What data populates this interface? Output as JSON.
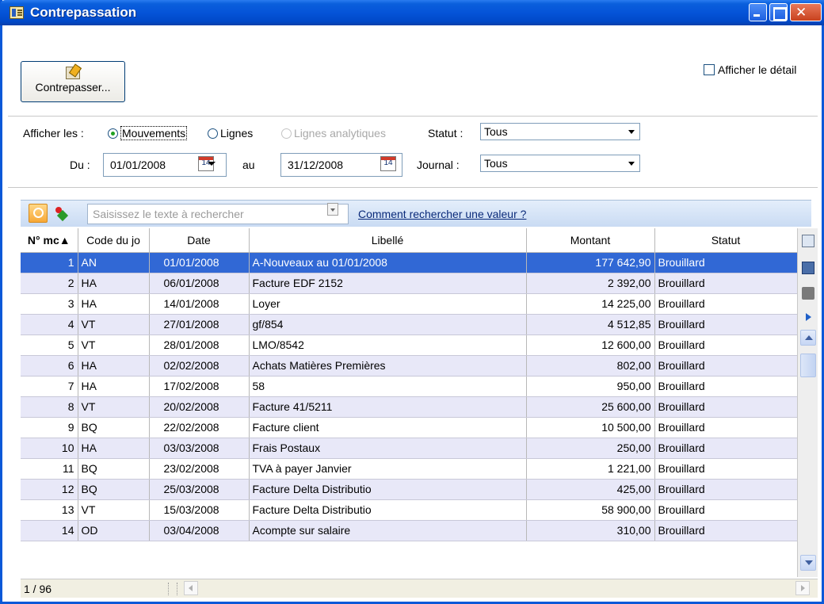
{
  "window": {
    "title": "Contrepassation"
  },
  "toolbar": {
    "contrepasser_label": "Contrepasser...",
    "show_detail_label": "Afficher le détail",
    "show_detail_checked": false
  },
  "filters": {
    "afficher_label": "Afficher les :",
    "radio_options": [
      {
        "label": "Mouvements",
        "selected": true,
        "enabled": true
      },
      {
        "label": "Lignes",
        "selected": false,
        "enabled": true
      },
      {
        "label": "Lignes analytiques",
        "selected": false,
        "enabled": false
      }
    ],
    "statut_label": "Statut :",
    "statut_value": "Tous",
    "du_label": "Du :",
    "du_value": "01/01/2008",
    "au_label": "au",
    "au_value": "31/12/2008",
    "journal_label": "Journal :",
    "journal_value": "Tous",
    "calendar_icon_text": "14"
  },
  "search": {
    "placeholder": "Saisissez le texte à rechercher",
    "help_link": "Comment rechercher une valeur ?"
  },
  "grid": {
    "columns": [
      "N° mc▲",
      "Code du jo",
      "Date",
      "Libellé",
      "Montant",
      "Statut"
    ],
    "rows": [
      {
        "num": "1",
        "code": "AN",
        "date": "01/01/2008",
        "libelle": "A-Nouveaux au 01/01/2008",
        "montant": "177 642,90",
        "statut": "Brouillard"
      },
      {
        "num": "2",
        "code": "HA",
        "date": "06/01/2008",
        "libelle": "Facture EDF 2152",
        "montant": "2 392,00",
        "statut": "Brouillard"
      },
      {
        "num": "3",
        "code": "HA",
        "date": "14/01/2008",
        "libelle": "Loyer",
        "montant": "14 225,00",
        "statut": "Brouillard"
      },
      {
        "num": "4",
        "code": "VT",
        "date": "27/01/2008",
        "libelle": "gf/854",
        "montant": "4 512,85",
        "statut": "Brouillard"
      },
      {
        "num": "5",
        "code": "VT",
        "date": "28/01/2008",
        "libelle": "LMO/8542",
        "montant": "12 600,00",
        "statut": "Brouillard"
      },
      {
        "num": "6",
        "code": "HA",
        "date": "02/02/2008",
        "libelle": "Achats Matières Premières",
        "montant": "802,00",
        "statut": "Brouillard"
      },
      {
        "num": "7",
        "code": "HA",
        "date": "17/02/2008",
        "libelle": "58",
        "montant": "950,00",
        "statut": "Brouillard"
      },
      {
        "num": "8",
        "code": "VT",
        "date": "20/02/2008",
        "libelle": "Facture 41/5211",
        "montant": "25 600,00",
        "statut": "Brouillard"
      },
      {
        "num": "9",
        "code": "BQ",
        "date": "22/02/2008",
        "libelle": "Facture client",
        "montant": "10 500,00",
        "statut": "Brouillard"
      },
      {
        "num": "10",
        "code": "HA",
        "date": "03/03/2008",
        "libelle": "Frais Postaux",
        "montant": "250,00",
        "statut": "Brouillard"
      },
      {
        "num": "11",
        "code": "BQ",
        "date": "23/02/2008",
        "libelle": "TVA à payer Janvier",
        "montant": "1 221,00",
        "statut": "Brouillard"
      },
      {
        "num": "12",
        "code": "BQ",
        "date": "25/03/2008",
        "libelle": "Facture Delta Distributio",
        "montant": "425,00",
        "statut": "Brouillard"
      },
      {
        "num": "13",
        "code": "VT",
        "date": "15/03/2008",
        "libelle": "Facture Delta Distributio",
        "montant": "58 900,00",
        "statut": "Brouillard"
      },
      {
        "num": "14",
        "code": "OD",
        "date": "03/04/2008",
        "libelle": "Acompte sur salaire",
        "montant": "310,00",
        "statut": "Brouillard"
      }
    ],
    "selected_row": 0
  },
  "status": {
    "count": "1 / 96"
  },
  "colors": {
    "titlebar": "#0554d8",
    "selection": "#3168d5",
    "alt_row": "#e8e8f8"
  }
}
